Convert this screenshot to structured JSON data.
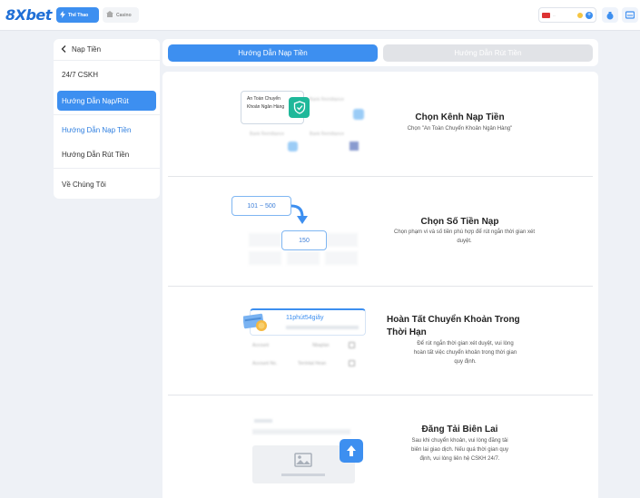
{
  "header": {
    "logo": "8Xbet",
    "nav": [
      {
        "label": "Thể Thao",
        "icon": "lightning-icon"
      },
      {
        "label": "Casino",
        "icon": "casino-icon"
      }
    ],
    "user_balance": "...",
    "icons": [
      "deposit-bag-icon",
      "wallet-card-icon"
    ]
  },
  "sidebar": {
    "back_label": "Nạp Tiền",
    "items": [
      {
        "label": "24/7 CSKH"
      },
      {
        "label": "Hướng Dẫn Nạp/Rút"
      },
      {
        "label": "Hướng Dẫn Nạp Tiền"
      },
      {
        "label": "Hướng Dẫn Rút Tiền"
      },
      {
        "label": "Về Chúng Tôi"
      }
    ]
  },
  "tabs": [
    {
      "label": "Hướng Dẫn Nạp Tiền",
      "active": true
    },
    {
      "label": "Hướng Dẫn Rút Tiền",
      "active": false
    }
  ],
  "steps": [
    {
      "title": "Chọn Kênh Nạp Tiền",
      "desc": "Chọn \"An Toàn Chuyển Khoản Ngân Hàng\"",
      "illus": {
        "card_text": "An Toàn Chuyển Khoản Ngân Hàng",
        "blur_labels": [
          "Bank Remittance",
          "Bank Remittance",
          "Bank Remittance"
        ]
      }
    },
    {
      "title": "Chọn Số Tiền Nạp",
      "desc": "Chọn phạm vi và số tiền phù hợp để rút ngắn thời gian xét duyệt.",
      "illus": {
        "range": "101 ~ 500",
        "amount": "150"
      }
    },
    {
      "title": "Hoàn Tất Chuyển Khoản Trong Thời Hạn",
      "desc": "Để rút ngắn thời gian xét duyệt, vui lòng hoàn tất việc chuyển khoản trong thời gian quy định.",
      "illus": {
        "timer": "11phút54giây",
        "rows": [
          {
            "k": "Account",
            "v": "Nbaplan"
          },
          {
            "k": "Account No.",
            "v": "Terrintal Hean"
          }
        ]
      }
    },
    {
      "title": "Đăng Tải Biên Lai",
      "desc": "Sau khi chuyển khoản, vui lòng đăng tải biên lai giao dịch. Nếu quá thời gian quy định, vui lòng liên hệ CSKH 24/7.",
      "illus": {}
    }
  ],
  "colors": {
    "accent": "#3d8ff0",
    "tab_inactive": "#e1e3e7",
    "page_bg": "#eef1f6"
  }
}
